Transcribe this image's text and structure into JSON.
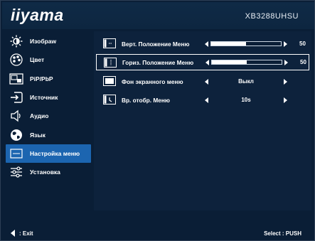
{
  "header": {
    "logo": "iiyama",
    "model": "XB3288UHSU"
  },
  "sidebar": {
    "items": [
      {
        "label": "Изобраw",
        "icon": "brightness-icon"
      },
      {
        "label": "Цвет",
        "icon": "color-palette-icon"
      },
      {
        "label": "PiP/PbP",
        "icon": "pip-icon"
      },
      {
        "label": "Источник",
        "icon": "input-source-icon"
      },
      {
        "label": "Аудио",
        "icon": "speaker-icon"
      },
      {
        "label": "Язык",
        "icon": "globe-icon"
      },
      {
        "label": "Настройка меню",
        "icon": "menu-settings-icon",
        "selected": true
      },
      {
        "label": "Установка",
        "icon": "sliders-icon"
      }
    ]
  },
  "panel": {
    "rows": [
      {
        "label": "Верт. Положение Меню",
        "type": "slider",
        "value": "50",
        "level": 0.5,
        "icon": "vertical-position-icon"
      },
      {
        "label": "Гориз. Положение Меню",
        "type": "slider",
        "value": "50",
        "level": 0.5,
        "icon": "horizontal-position-icon",
        "active": true
      },
      {
        "label": "Фон экранного меню",
        "type": "option",
        "value": "Выкл",
        "icon": "osd-background-icon"
      },
      {
        "label": "Вр. отобр. Меню",
        "type": "option",
        "value": "10s",
        "icon": "osd-timeout-icon"
      }
    ]
  },
  "footer": {
    "exit": ": Exit",
    "select": "Select : PUSH"
  },
  "colors": {
    "background": "#0a1e36",
    "selected": "#1c65b0",
    "text": "#ffffff"
  }
}
